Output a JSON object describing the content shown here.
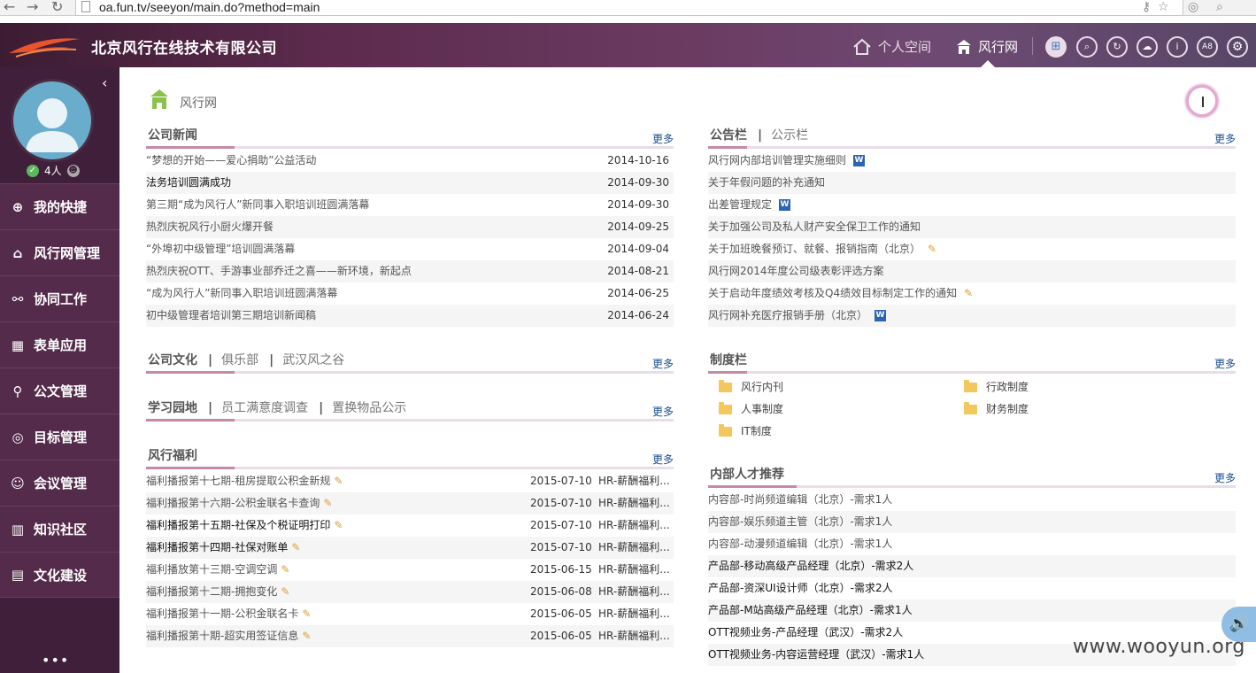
{
  "browser": {
    "url": "oa.fun.tv/seeyon/main.do?method=main",
    "back_icon": "back-arrow-icon",
    "forward_icon": "forward-arrow-icon",
    "reload_icon": "reload-icon"
  },
  "header": {
    "company": "北京风行在线技术有限公司",
    "nav": [
      {
        "label": "个人空间",
        "icon": "home-icon"
      },
      {
        "label": "风行网",
        "icon": "building-icon"
      }
    ],
    "tools": [
      {
        "icon": "windows-icon",
        "glyph": "⊞"
      },
      {
        "icon": "search-icon",
        "glyph": "⌕"
      },
      {
        "icon": "refresh-icon",
        "glyph": "↻"
      },
      {
        "icon": "cloud-icon",
        "glyph": "☁"
      },
      {
        "icon": "info-icon",
        "glyph": "i"
      },
      {
        "icon": "font-size-icon",
        "glyph": "A8"
      },
      {
        "icon": "gear-icon",
        "glyph": "⚙"
      }
    ]
  },
  "sidebar": {
    "online": "4人",
    "items": [
      {
        "label": "我的快捷",
        "glyph": "⊕"
      },
      {
        "label": "风行网管理",
        "glyph": "⌂"
      },
      {
        "label": "协同工作",
        "glyph": "⚯"
      },
      {
        "label": "表单应用",
        "glyph": "▦"
      },
      {
        "label": "公文管理",
        "glyph": "⚲"
      },
      {
        "label": "目标管理",
        "glyph": "◎"
      },
      {
        "label": "会议管理",
        "glyph": "☺"
      },
      {
        "label": "知识社区",
        "glyph": "▥"
      },
      {
        "label": "文化建设",
        "glyph": "▤"
      }
    ],
    "more": "•••"
  },
  "page": {
    "title": "风行网"
  },
  "more_label": "更多",
  "news": {
    "title": "公司新闻",
    "rows": [
      {
        "title": "“梦想的开始——爱心捐助”公益活动",
        "date": "2014-10-16",
        "dark": false
      },
      {
        "title": "法务培训圆满成功",
        "date": "2014-09-30",
        "dark": true
      },
      {
        "title": "第三期“成为风行人”新同事入职培训班圆满落幕",
        "date": "2014-09-30",
        "dark": false
      },
      {
        "title": "热烈庆祝风行小厨火爆开餐",
        "date": "2014-09-25",
        "dark": false
      },
      {
        "title": "“外埠初中级管理”培训圆满落幕",
        "date": "2014-09-04",
        "dark": false
      },
      {
        "title": "热烈庆祝OTT、手游事业部乔迁之喜——新环境，新起点",
        "date": "2014-08-21",
        "dark": false
      },
      {
        "title": "“成为风行人”新同事入职培训班圆满落幕",
        "date": "2014-06-25",
        "dark": false
      },
      {
        "title": "初中级管理者培训第三期培训新闻稿",
        "date": "2014-06-24",
        "dark": false
      }
    ]
  },
  "culture": {
    "tabs": [
      "公司文化",
      "俱乐部",
      "武汉风之谷"
    ]
  },
  "study": {
    "tabs": [
      "学习园地",
      "员工满意度调查",
      "置换物品公示"
    ]
  },
  "welfare": {
    "title": "风行福利",
    "rows": [
      {
        "title": "福利播报第十七期-租房提取公积金新规",
        "date": "2015-07-10",
        "author": "HR-薪酬福利...",
        "dark": false
      },
      {
        "title": "福利播报第十六期-公积金联名卡查询",
        "date": "2015-07-10",
        "author": "HR-薪酬福利...",
        "dark": false
      },
      {
        "title": "福利播报第十五期-社保及个税证明打印",
        "date": "2015-07-10",
        "author": "HR-薪酬福利...",
        "dark": true
      },
      {
        "title": "福利播报第十四期-社保对账单",
        "date": "2015-07-10",
        "author": "HR-薪酬福利...",
        "dark": true
      },
      {
        "title": "福利播放第十三期-空调空调",
        "date": "2015-06-15",
        "author": "HR-薪酬福利...",
        "dark": false
      },
      {
        "title": "福利播报第十二期-拥抱变化",
        "date": "2015-06-08",
        "author": "HR-薪酬福利...",
        "dark": false
      },
      {
        "title": "福利播报第十一期-公积金联名卡",
        "date": "2015-06-05",
        "author": "HR-薪酬福利...",
        "dark": false
      },
      {
        "title": "福利播报第十期-超实用签证信息",
        "date": "2015-06-05",
        "author": "HR-薪酬福利...",
        "dark": false
      }
    ]
  },
  "notice": {
    "tabs": [
      "公告栏",
      "公示栏"
    ],
    "rows": [
      {
        "title": "风行网内部培训管理实施细则",
        "badge": "word"
      },
      {
        "title": "关于年假问题的补充通知",
        "badge": ""
      },
      {
        "title": "出差管理规定",
        "badge": "word"
      },
      {
        "title": "关于加强公司及私人财产安全保卫工作的通知",
        "badge": ""
      },
      {
        "title": "关于加班晚餐预订、就餐、报销指南（北京）",
        "badge": "clip"
      },
      {
        "title": "风行网2014年度公司级表彰评选方案",
        "badge": ""
      },
      {
        "title": "关于启动年度绩效考核及Q4绩效目标制定工作的通知",
        "badge": "clip"
      },
      {
        "title": "风行网补充医疗报销手册（北京）",
        "badge": "word"
      }
    ]
  },
  "policy": {
    "title": "制度栏",
    "folders": [
      "风行内刊",
      "行政制度",
      "人事制度",
      "财务制度",
      "IT制度"
    ]
  },
  "talent": {
    "title": "内部人才推荐",
    "rows": [
      {
        "title": "内容部-时尚频道编辑（北京）-需求1人",
        "dark": false
      },
      {
        "title": "内容部-娱乐频道主管（北京）-需求1人",
        "dark": false
      },
      {
        "title": "内容部-动漫频道编辑（北京）-需求1人",
        "dark": false
      },
      {
        "title": "产品部-移动高级产品经理（北京）-需求2人",
        "dark": true
      },
      {
        "title": "产品部-资深UI设计师（北京）-需求2人",
        "dark": true
      },
      {
        "title": "产品部-M站高级产品经理（北京）-需求1人",
        "dark": true
      },
      {
        "title": "OTT视频业务-产品经理（武汉）-需求2人",
        "dark": true
      },
      {
        "title": "OTT视频业务-内容运营经理（武汉）-需求1人",
        "dark": true
      }
    ]
  },
  "watermark": "www.wooyun.org",
  "word_badge": "W"
}
